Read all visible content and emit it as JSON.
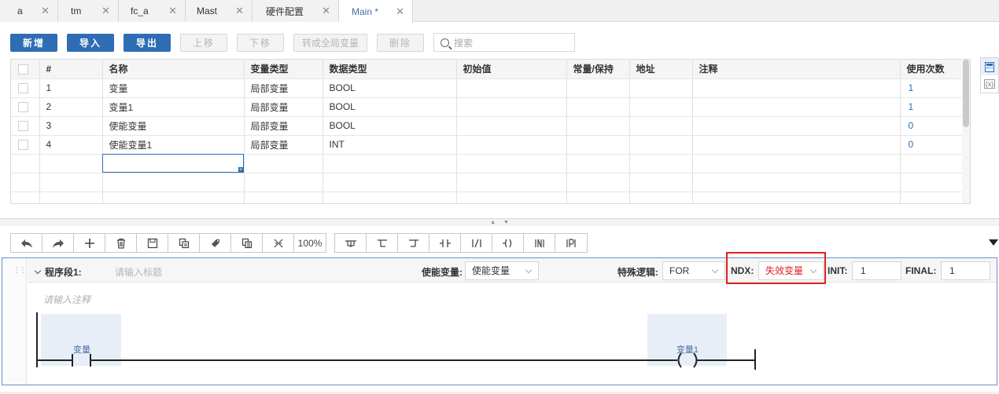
{
  "tabs": [
    {
      "label": "a",
      "active": false
    },
    {
      "label": "tm",
      "active": false
    },
    {
      "label": "fc_a",
      "active": false
    },
    {
      "label": "Mast",
      "active": false
    },
    {
      "label": "硬件配置",
      "active": false
    },
    {
      "label": "Main *",
      "active": true
    }
  ],
  "tab_close_glyph": "✕",
  "toolbar": {
    "add": "新增",
    "import": "导入",
    "export": "导出",
    "move_up": "上移",
    "move_down": "下移",
    "to_global": "转成全局变量",
    "delete": "删除",
    "search_placeholder": "搜索"
  },
  "table": {
    "columns": [
      "#",
      "名称",
      "变量类型",
      "数据类型",
      "初始值",
      "常量/保持",
      "地址",
      "注释",
      "使用次数"
    ],
    "rows": [
      {
        "num": "1",
        "name": "变量",
        "var_type": "局部变量",
        "data_type": "BOOL",
        "init": "",
        "const": "",
        "addr": "",
        "comment": "",
        "uses": "1"
      },
      {
        "num": "2",
        "name": "变量1",
        "var_type": "局部变量",
        "data_type": "BOOL",
        "init": "",
        "const": "",
        "addr": "",
        "comment": "",
        "uses": "1"
      },
      {
        "num": "3",
        "name": "使能变量",
        "var_type": "局部变量",
        "data_type": "BOOL",
        "init": "",
        "const": "",
        "addr": "",
        "comment": "",
        "uses": "0"
      },
      {
        "num": "4",
        "name": "使能变量1",
        "var_type": "局部变量",
        "data_type": "INT",
        "init": "",
        "const": "",
        "addr": "",
        "comment": "",
        "uses": "0"
      }
    ]
  },
  "ladder_toolbar": {
    "icons": [
      "undo-icon",
      "redo-icon",
      "add-icon",
      "delete-icon",
      "save-icon",
      "copy-icon",
      "tag-icon",
      "paste-icon",
      "fit-icon"
    ],
    "zoom": "100%",
    "elements": [
      "branch-down-icon",
      "branch-start-icon",
      "branch-end-icon",
      "contact-no-icon",
      "contact-nc-icon",
      "coil-icon",
      "negated-contact-icon",
      "positive-contact-icon"
    ]
  },
  "segment": {
    "title": "程序段1:",
    "title_placeholder": "请输入标题",
    "enable_label": "使能变量:",
    "enable_value": "使能变量",
    "special_label": "特殊逻辑:",
    "special_value": "FOR",
    "ndx_label": "NDX:",
    "ndx_value": "失效变量",
    "init_label": "INIT:",
    "init_value": "1",
    "final_label": "FINAL:",
    "final_value": "1",
    "comment_placeholder": "请输入注释",
    "contact_var": "变量",
    "coil_var": "变量1"
  },
  "colors": {
    "primary": "#2e6db4",
    "invalid": "#e02020",
    "cell_bg": "#e8eef7"
  }
}
